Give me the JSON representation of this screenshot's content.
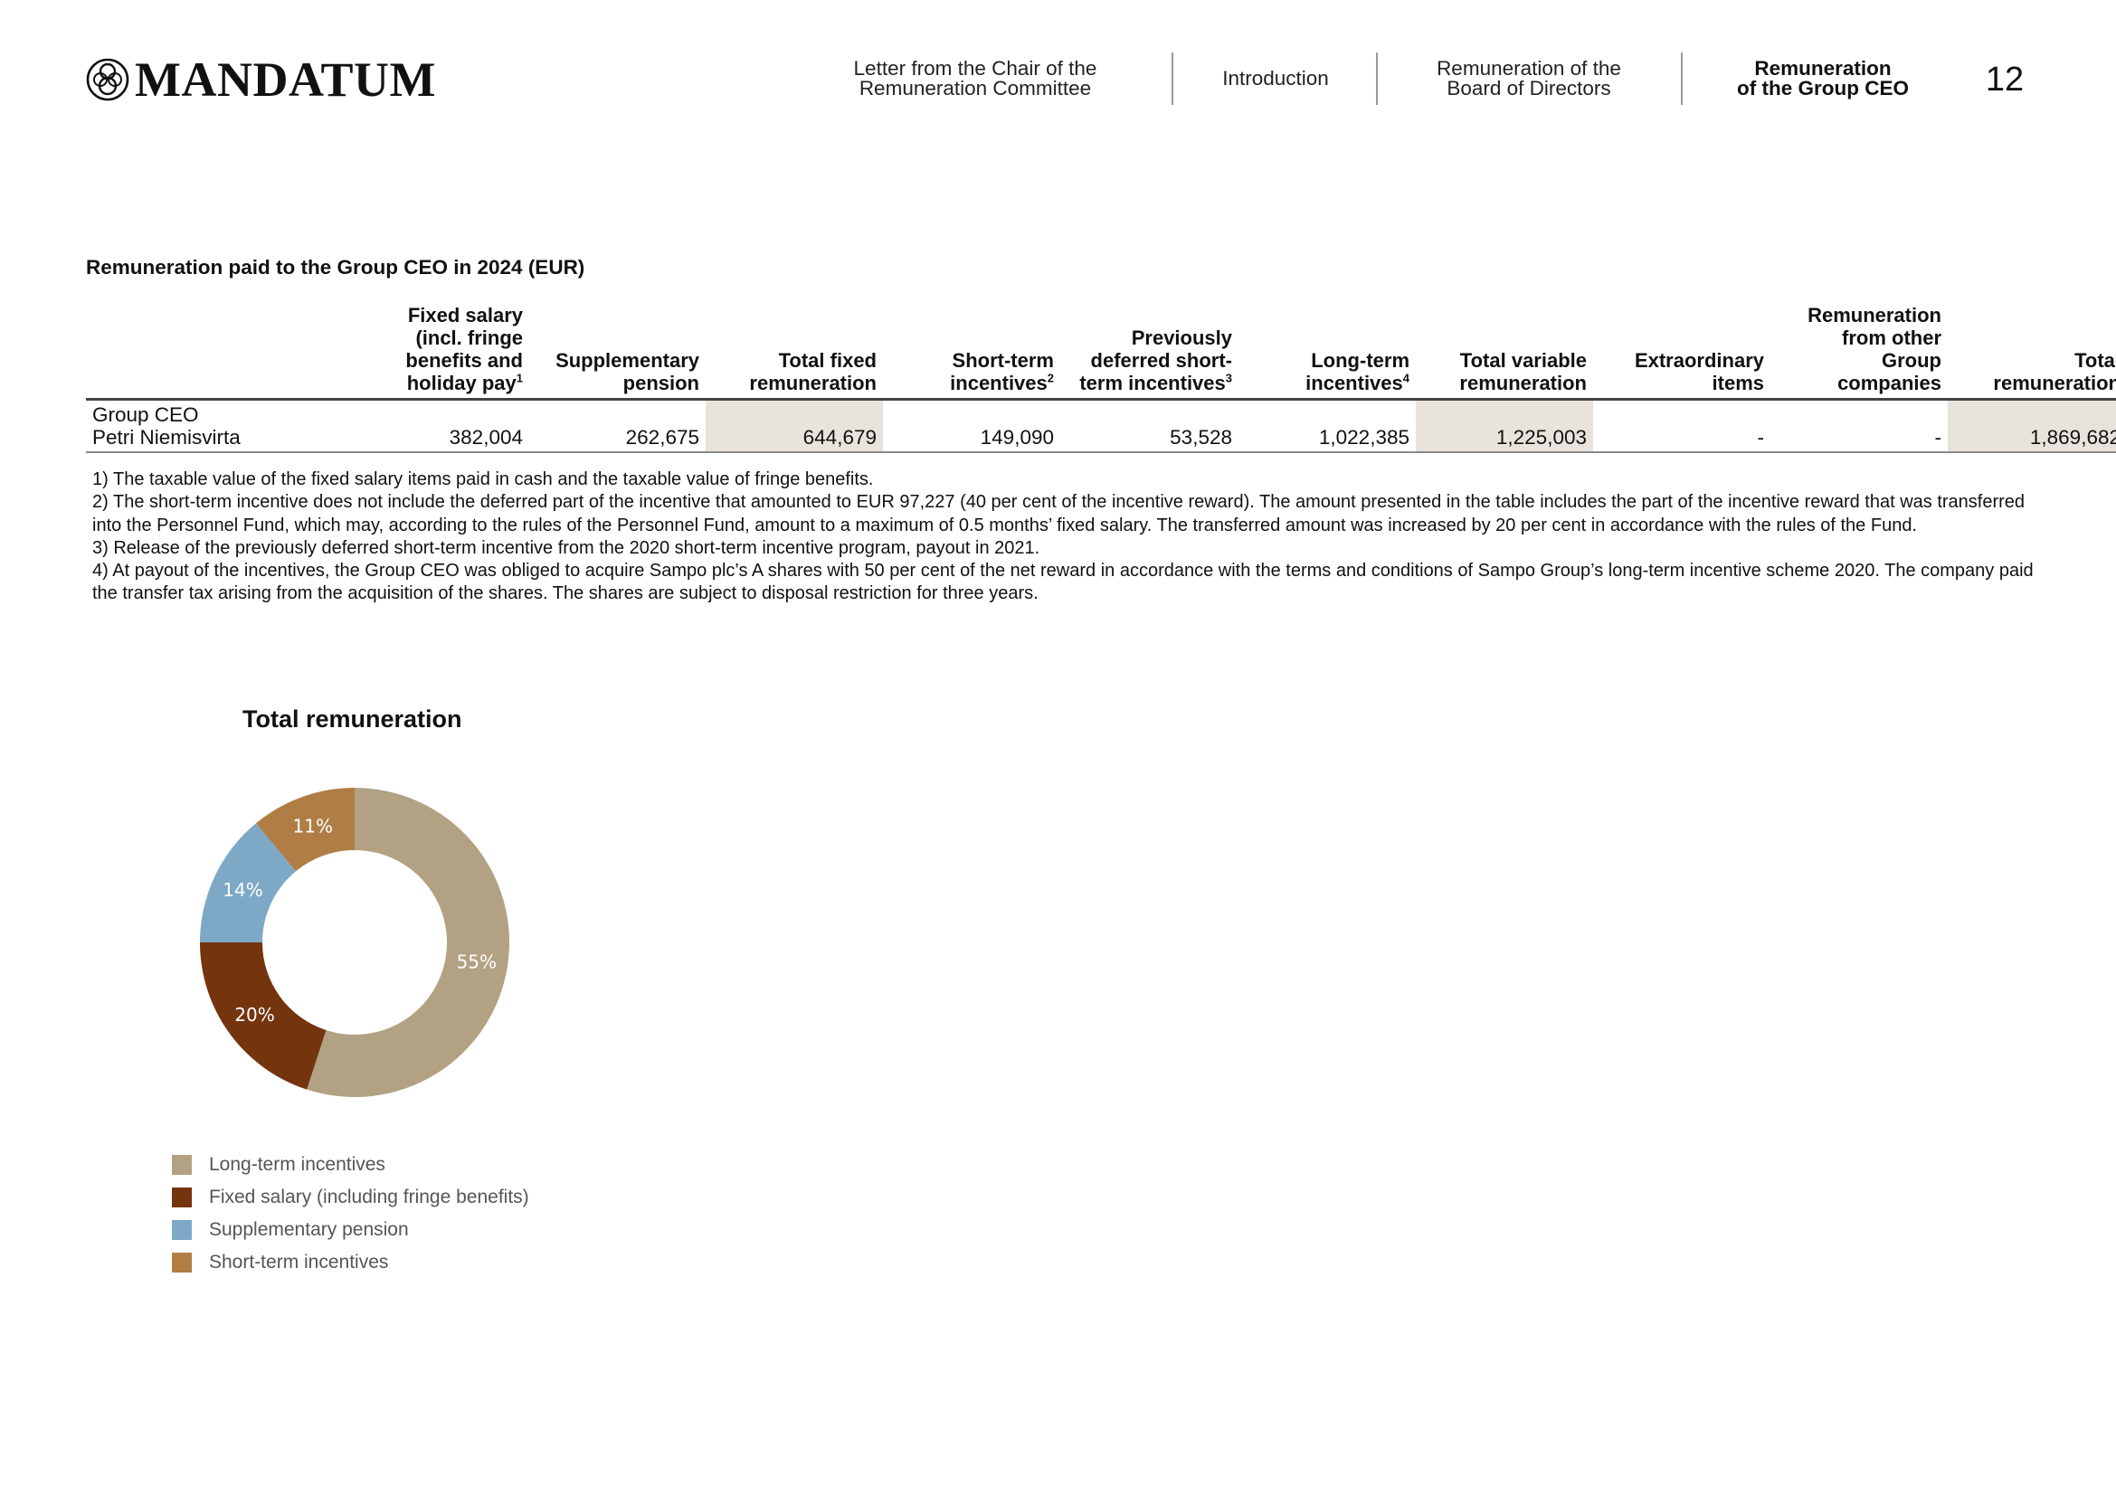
{
  "header": {
    "brand": "MANDATUM",
    "nav": [
      {
        "label": "Letter from the Chair of the\nRemuneration Committee",
        "active": false
      },
      {
        "label": "Introduction",
        "active": false
      },
      {
        "label": "Remuneration of the\nBoard of Directors",
        "active": false
      },
      {
        "label": "Remuneration\nof the Group CEO",
        "active": true
      }
    ],
    "page_number": "12"
  },
  "table": {
    "title": "Remuneration paid to the Group CEO in 2024 (EUR)",
    "columns": [
      {
        "label": "",
        "sup": ""
      },
      {
        "label": "Fixed salary\n(incl. fringe\nbenefits and\nholiday pay",
        "sup": "1"
      },
      {
        "label": "Supplementary\npension",
        "sup": ""
      },
      {
        "label": "Total fixed\nremuneration",
        "sup": ""
      },
      {
        "label": "Short-term\nincentives",
        "sup": "2"
      },
      {
        "label": "Previously\ndeferred short-\nterm incentives",
        "sup": "3"
      },
      {
        "label": "Long-term\nincentives",
        "sup": "4"
      },
      {
        "label": "Total variable\nremuneration",
        "sup": ""
      },
      {
        "label": "Extraordinary\nitems",
        "sup": ""
      },
      {
        "label": "Remuneration\nfrom other\nGroup\ncompanies",
        "sup": ""
      },
      {
        "label": "Total\nremuneration",
        "sup": ""
      }
    ],
    "rows": [
      {
        "label_line1": "Group CEO",
        "label_line2": "Petri Niemisvirta",
        "values": [
          "382,004",
          "262,675",
          "644,679",
          "149,090",
          "53,528",
          "1,022,385",
          "1,225,003",
          "-",
          "-",
          "1,869,682"
        ]
      }
    ]
  },
  "footnotes": [
    "1) The taxable value of the fixed salary items paid in cash and the taxable value of fringe benefits.",
    "2) The short-term incentive does not include the deferred part of the incentive that amounted to EUR 97,227 (40 per cent of the incentive reward). The amount presented in the table includes the part of the incentive reward that was transferred into the Personnel Fund, which may, according to the rules of the Personnel Fund, amount to a maximum of 0.5 months’ fixed salary. The transferred amount was increased by 20 per cent in accordance with the rules of the Fund.",
    "3) Release of the previously deferred short-term incentive from the 2020 short-term incentive program, payout in 2021.",
    "4) At payout of the incentives, the Group CEO was obliged to acquire Sampo plc’s A shares with 50 per cent of the net reward in accordance with the terms and conditions of Sampo Group’s long-term incentive scheme 2020. The company paid the transfer tax arising from the acquisition of the shares. The shares are subject to disposal restriction for three years."
  ],
  "chart_data": {
    "type": "pie",
    "donut": true,
    "title": "Total remuneration",
    "categories": [
      "Long-term incentives",
      "Fixed salary (including fringe benefits)",
      "Supplementary pension",
      "Short-term incentives"
    ],
    "values": [
      55,
      20,
      14,
      11
    ],
    "labels": [
      "55%",
      "20%",
      "14%",
      "11%"
    ],
    "colors": [
      "#b2a283",
      "#73340e",
      "#7da9c7",
      "#b07e45"
    ],
    "legend_position": "bottom-left"
  }
}
